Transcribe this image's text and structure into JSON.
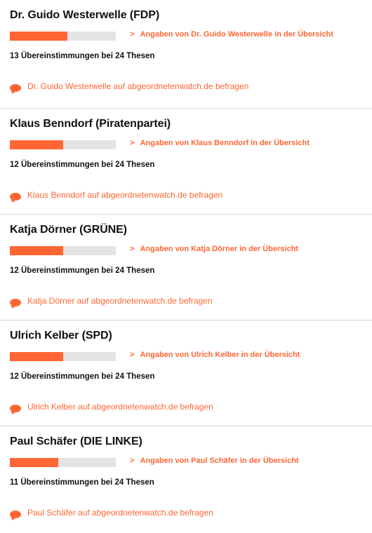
{
  "colors": {
    "accent": "#ff6633",
    "bar_track": "#e4e4e4",
    "divider": "#d6d6d6"
  },
  "icons": {
    "link": "chevron-right-icon",
    "ask": "speech-bubble-icon"
  },
  "candidates": [
    {
      "name": "Dr. Guido Westerwelle (FDP)",
      "overview_link": "Angaben von Dr. Guido Westerwelle in der Übersicht",
      "matches_text": "13 Übereinstimmungen bei 24 Thesen",
      "match_fraction": 0.54,
      "ask_link": "Dr. Guido Westerwelle auf abgeordnetenwatch.de befragen"
    },
    {
      "name": "Klaus Benndorf (Piratenpartei)",
      "overview_link": "Angaben von Klaus Benndorf in der Übersicht",
      "matches_text": "12 Übereinstimmungen bei 24 Thesen",
      "match_fraction": 0.5,
      "ask_link": "Klaus Benndorf auf abgeordnetenwatch.de befragen"
    },
    {
      "name": "Katja Dörner (GRÜNE)",
      "overview_link": "Angaben von Katja Dörner in der Übersicht",
      "matches_text": "12 Übereinstimmungen bei 24 Thesen",
      "match_fraction": 0.5,
      "ask_link": "Katja Dörner auf abgeordnetenwatch.de befragen"
    },
    {
      "name": "Ulrich Kelber (SPD)",
      "overview_link": "Angaben von Ulrich Kelber in der Übersicht",
      "matches_text": "12 Übereinstimmungen bei 24 Thesen",
      "match_fraction": 0.5,
      "ask_link": "Ulrich Kelber auf abgeordnetenwatch.de befragen"
    },
    {
      "name": "Paul Schäfer (DIE LINKE)",
      "overview_link": "Angaben von Paul Schäfer in der Übersicht",
      "matches_text": "11 Übereinstimmungen bei 24 Thesen",
      "match_fraction": 0.46,
      "ask_link": "Paul Schäfer auf abgeordnetenwatch.de befragen"
    }
  ]
}
